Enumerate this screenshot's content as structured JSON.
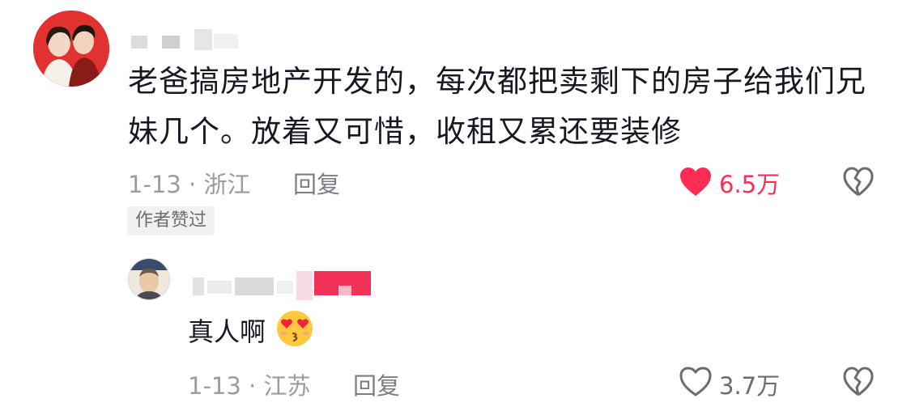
{
  "comments": [
    {
      "text": "老爸搞房地产开发的，每次都把卖剩下的房子给我们兄妹几个。放着又可惜，收租又累还要装修",
      "date_location": "1-13 · 浙江",
      "reply_label": "回复",
      "likes": "6.5万",
      "liked": true,
      "badge": "作者赞过",
      "icons": {
        "like": "heart-filled-icon",
        "dislike": "broken-heart-icon"
      }
    },
    {
      "text": "真人啊",
      "emoji": "kissing-heart-eyes-emoji",
      "date_location": "1-13 · 江苏",
      "reply_label": "回复",
      "likes": "3.7万",
      "liked": false,
      "icons": {
        "like": "heart-outline-icon",
        "dislike": "broken-heart-icon"
      }
    }
  ],
  "colors": {
    "like_active": "#fe2c55",
    "meta_gray": "#9b9ba2",
    "text": "#161823"
  }
}
